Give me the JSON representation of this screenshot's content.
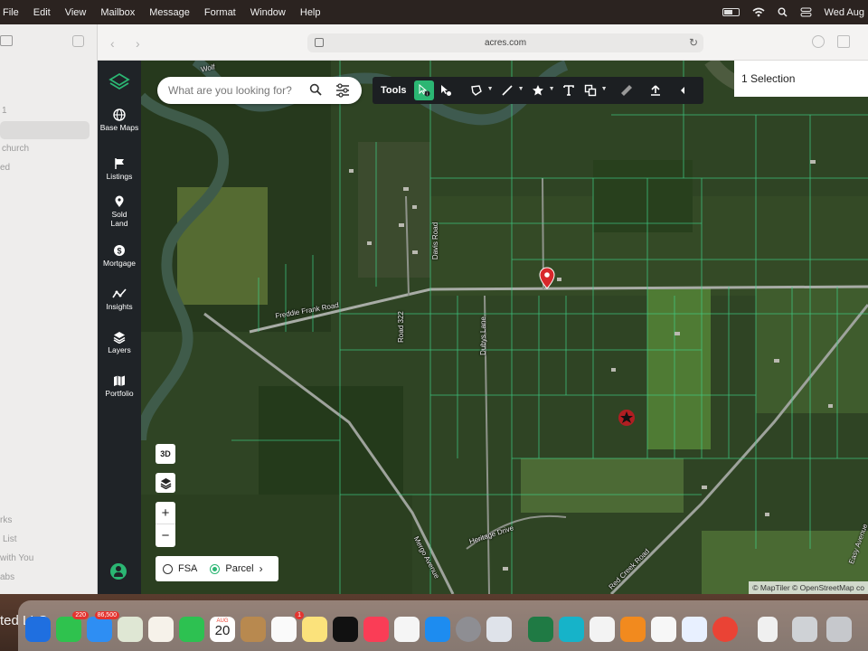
{
  "menubar": {
    "menus": [
      "File",
      "Edit",
      "View",
      "Mailbox",
      "Message",
      "Format",
      "Window",
      "Help"
    ],
    "clock": "Wed Aug"
  },
  "browser": {
    "sidebar_items": [
      "1",
      "church",
      "ed",
      "rks",
      "List",
      "with You",
      "abs"
    ],
    "url": "acres.com"
  },
  "rail": {
    "items": [
      "Base Maps",
      "Listings",
      "Sold Land",
      "Mortgage",
      "Insights",
      "Layers",
      "Portfolio"
    ]
  },
  "search": {
    "placeholder": "What are you looking for?"
  },
  "tools": {
    "label": "Tools",
    "icons": [
      "select-info-icon",
      "select-parcel-icon",
      "polygon-icon",
      "line-icon",
      "star-icon",
      "text-icon",
      "shapes-icon",
      "ruler-icon",
      "upload-icon",
      "collapse-icon"
    ]
  },
  "selection_panel": {
    "title": "1 Selection"
  },
  "map_controls": {
    "three_d": "3D",
    "zoom_in": "+",
    "zoom_out": "−",
    "layer_options": [
      "FSA",
      "Parcel"
    ],
    "selected_layer": "Parcel"
  },
  "map_labels": {
    "roads": [
      "Freddie Frank Road",
      "Road 322",
      "Davis Road",
      "Dubys Lane",
      "Heritage Drive",
      "Mergo Avenue",
      "Red Creek Road",
      "Easy Avenue",
      "Wolf"
    ]
  },
  "attribution": "© MapTiler © OpenStreetMap co",
  "dock": {
    "partial_text": "ted LLC",
    "calendar_month": "AUG",
    "calendar_day": "20",
    "badges": [
      "220",
      "86,500",
      "1"
    ]
  },
  "colors": {
    "accent": "#2bb673",
    "rail": "#1f2327",
    "parcel_lines": "#3fd38a",
    "pin": "#d8272b"
  }
}
